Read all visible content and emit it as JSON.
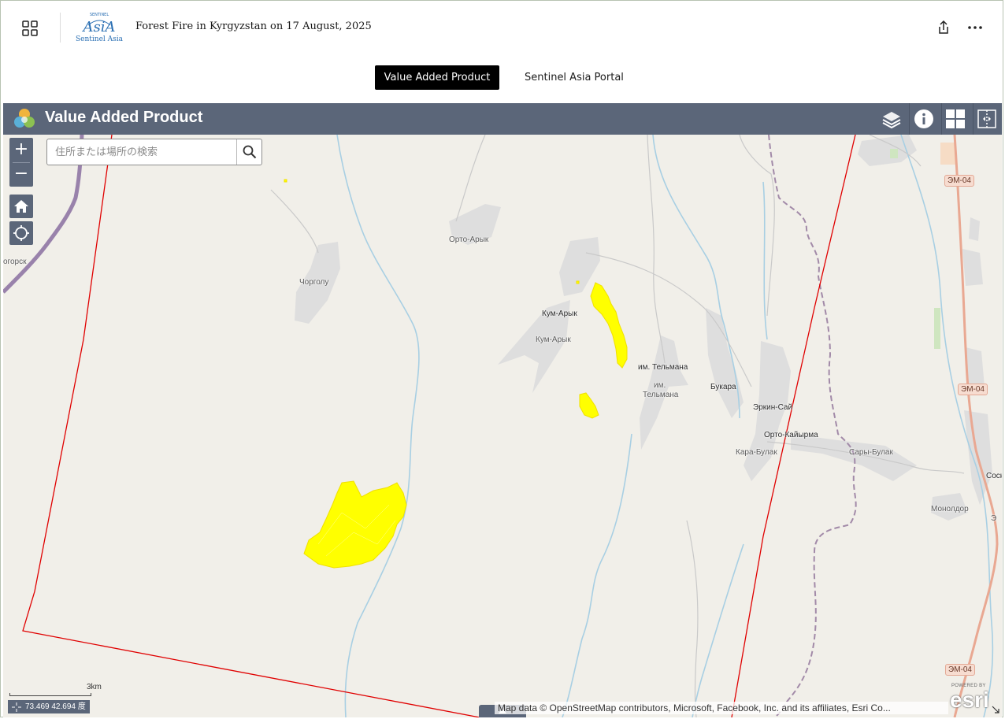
{
  "header": {
    "title": "Forest Fire in Kyrgyzstan on 17 August, 2025",
    "logo_text": "Sentinel Asia",
    "logo_mark": "AsiA",
    "logo_small": "SENTINEL"
  },
  "nav": {
    "tabs": [
      {
        "label": "Value Added Product",
        "active": true
      },
      {
        "label": "Sentinel Asia Portal",
        "active": false
      }
    ]
  },
  "appbar": {
    "title": "Value Added Product",
    "color": "#5b6679",
    "tools": [
      "layers-icon",
      "info-icon",
      "basemap-gallery-icon",
      "swipe-icon"
    ]
  },
  "map": {
    "search_placeholder": "住所または場所の検索",
    "zoom_in": "+",
    "zoom_out": "−",
    "places": {
      "p1": "Орто-Арык",
      "p2": "Чорголу",
      "p3": "Кум-Арык",
      "p4": "Кум-Арык",
      "p5": "им. Тельмана",
      "p6": "им.",
      "p7": "Тельмана",
      "p8": "Букара",
      "p9": "Эркин-Сай",
      "p10": "Орто-Кайырма",
      "p11": "Кара-Булак",
      "p12": "Сары-Булак",
      "p13": "Монолдор",
      "p14": "Сосн",
      "p15": "Э",
      "p16": "огорск"
    },
    "road_shields": [
      "ЭМ-04",
      "ЭМ-04",
      "ЭМ-04"
    ],
    "scale_label": "3km",
    "coordinates": "73.469 42.694 度",
    "attribution": "Map data © OpenStreetMap contributors, Microsoft, Facebook, Inc. and its affiliates, Esri Co...",
    "esri_powered": "POWERED BY",
    "esri_logo": "esri",
    "colors": {
      "fire_area": "#ffff00",
      "aoi_boundary": "#e00000",
      "water": "#a8cfe3",
      "border": "#a28aa8",
      "major_road": "#e9a892",
      "urban": "#dcdcdc"
    }
  }
}
